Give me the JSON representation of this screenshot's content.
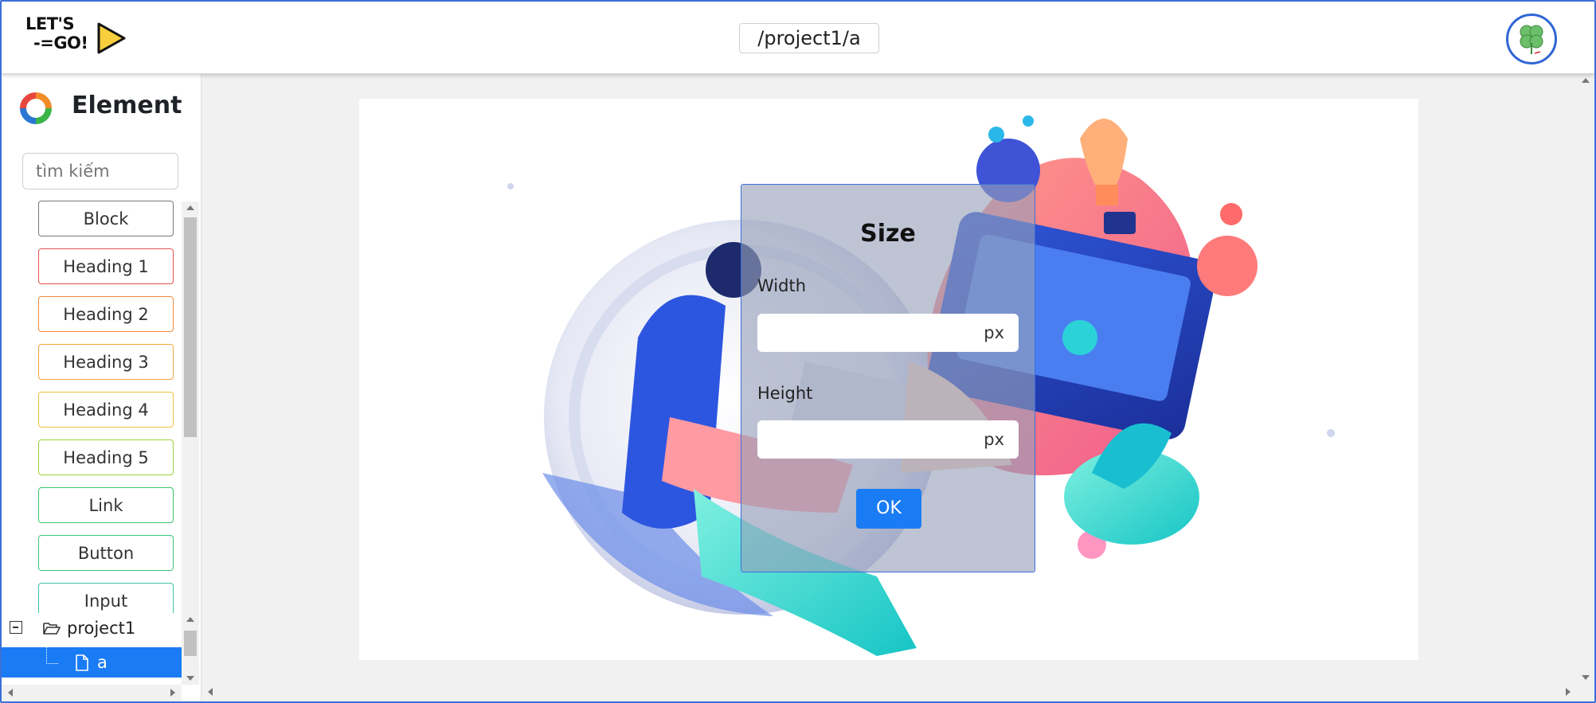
{
  "header": {
    "logo_line1": "LET'S",
    "logo_line2": "GO!",
    "path": "/project1/a"
  },
  "sidebar": {
    "title": "Element",
    "search_placeholder": "tìm kiếm",
    "elements": [
      {
        "label": "Block",
        "color": "#777777"
      },
      {
        "label": "Heading 1",
        "color": "#e65353"
      },
      {
        "label": "Heading 2",
        "color": "#f0893a"
      },
      {
        "label": "Heading 3",
        "color": "#f2a63a"
      },
      {
        "label": "Heading 4",
        "color": "#f0c23a"
      },
      {
        "label": "Heading 5",
        "color": "#9bd13a"
      },
      {
        "label": "Link",
        "color": "#3cc46e"
      },
      {
        "label": "Button",
        "color": "#3cc47e"
      },
      {
        "label": "Input",
        "color": "#3cc4a8"
      }
    ],
    "tree": {
      "folder": "project1",
      "file": "a"
    }
  },
  "dialog": {
    "title": "Size",
    "width_label": "Width",
    "width_unit": "px",
    "height_label": "Height",
    "height_unit": "px",
    "ok_label": "OK"
  },
  "colors": {
    "accent": "#1a7cf4",
    "frame_border": "#3b6fd8"
  }
}
